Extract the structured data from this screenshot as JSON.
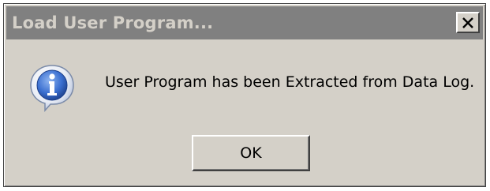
{
  "window": {
    "title": "Load User Program...",
    "close_icon": "close-icon"
  },
  "dialog": {
    "icon": "info-icon",
    "message": "User Program has been Extracted from Data Log.",
    "ok_label": "OK"
  },
  "colors": {
    "titlebar_inactive": "#808080",
    "title_text": "#d4d0c8",
    "window_face": "#d4d0c8",
    "info_icon_blue": "#3a6fd0"
  }
}
